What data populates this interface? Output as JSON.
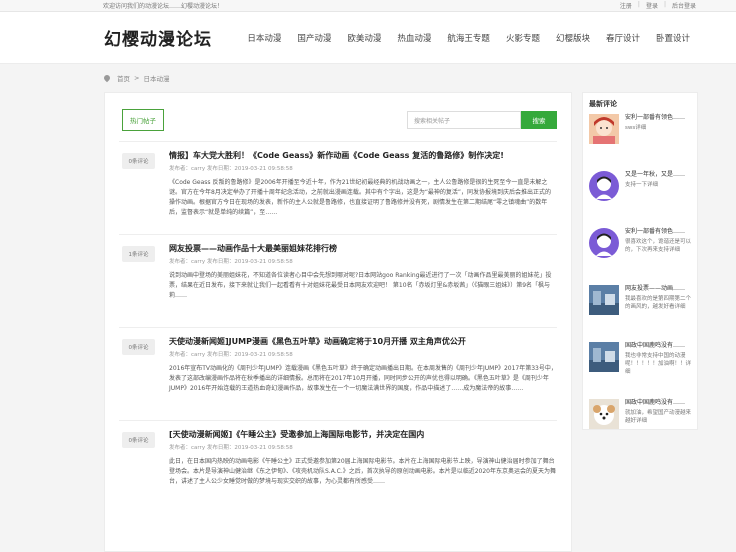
{
  "topbar": {
    "welcome": "欢迎访问我们的动漫论坛……幻樱动漫论坛！",
    "register": "注册",
    "login": "登录",
    "admin": "后台登录"
  },
  "header": {
    "logo": "幻樱动漫论坛",
    "nav": [
      "日本动漫",
      "国产动漫",
      "欧美动漫",
      "热血动漫",
      "航海王专题",
      "火影专题",
      "幻樱版块",
      "春厅设计",
      "卧置设计"
    ]
  },
  "breadcrumb": {
    "home": "首页",
    "sep": ">",
    "current": "日本动漫"
  },
  "toolbar": {
    "hot_label": "热门帖子",
    "search_placeholder": "搜索相关帖子",
    "search_button": "搜索"
  },
  "posts": [
    {
      "badge": "0条评论",
      "title": "情报】车大党大胜利！《Code Geass》新作动画《Code Geass 复活的鲁路修》制作决定!",
      "meta": "发布者：carry   发布日期：2019-03-21 09:58:58",
      "excerpt": "《Code Geass 反叛的鲁路修》是2006年开播至今近十年，作为21世纪初最经典的机战动画之一，主人公鲁路修是很的生死至今一直是未解之谜。官方在今年8月决定举办了开播十周年纪念活动，之前就出漫画连载。其中有个字出，这是为“最神的复活”，同发协报境到庆后会推出正式的操作动画。根据官方今日在现场的发表，新作的主人公就是鲁路修，也直接证明了鲁路修并没有死，剧情发生在第二期结尾“零之镇魂曲”的数年后，监督表示“就是单纯的续篇”，至……"
    },
    {
      "badge": "1条评论",
      "title": "网友投票——动画作品十大最美丽姐妹花排行榜",
      "meta": "发布者：carry   发布日期：2019-03-21 09:58:58",
      "excerpt": "说到动画中登场的美丽姐妹花，不知道各位读者心目中会先想到哪对呢?日本网站goo Ranking最近进行了一次「动画作品里最美丽的姐妹花」投票，结果在近日发布，接下来就让我们一起看看有十对姐妹花最受日本网友欢迎吧！   第10名「赤坂灯里&赤坂茜」（《猫眼三姐妹》）第9名「枫与莉……"
    },
    {
      "badge": "0条评论",
      "title": "天使动漫新闻姬]JUMP漫画《黑色五叶草》动画确定将于10月开播 双主角声优公开",
      "meta": "发布者：carry   发布日期：2019-03-21 09:58:58",
      "excerpt": "2016年宣布TV动画化的《周刊少年JUMP》连载漫画《黑色五叶草》终于确定动画播出日期。在本周发售的《周刊少年JUMP》2017年第33号中，发表了这部改编漫画作品将在秋季播出的详细情报。总而将在2017年10月开播，同时同步公开的声优也得以明确。《黑色五叶草》是《周刊少年JUMP》2016年开始连载的王道热血奇幻漫画作品，故事发生在一个一切魔法满世界的国度，作品中描述了……成为魔法帝的故事……"
    },
    {
      "badge": "0条评论",
      "title": "[天使动漫新闻姬]《午睡公主》受邀参加上海国际电影节，并决定在国内",
      "meta": "发布者：carry   发布日期：2019-03-21 09:58:58",
      "excerpt": "此日，在日本国内热映的动画电影《午睡公主》正式受邀参加第20届上海国际电影节。本片在上海国际电影节上映，导演神山健治届时参加了舞台登场会。本片是导演神山健治继《东之伊甸》、《攻壳机动队S.A.C.》之后，首次执导的原创动画电影。本片是以临近2020年东京奥运会的夏天为舞台，讲述了主人公少女睡觉时做的梦境与现实交织的故事，为心灵都有所感受……"
    }
  ],
  "sidebar": {
    "title": "最新评论",
    "items": [
      {
        "name": "安利一部番有领色……",
        "text": "sws详细"
      },
      {
        "name": "又是一年秋，又是……",
        "text": "支持一下详细"
      },
      {
        "name": "安利一部番有领色……",
        "text": "很喜欢这个，诡谐还是可以的，下次再来支持详细"
      },
      {
        "name": "网友投票——动画……",
        "text": "我最喜欢的是第四期第二个的画风的，越发好看详细"
      },
      {
        "name": "国政中国鹿鸣没有……",
        "text": "我也非常支持中国的动漫呢！！！！！加油啊！！详细"
      },
      {
        "name": "国政中国鹿鸣没有……",
        "text": "就加油，希望国产动漫越来越好详细"
      }
    ]
  },
  "colors": {
    "accent": "#35a93b"
  }
}
